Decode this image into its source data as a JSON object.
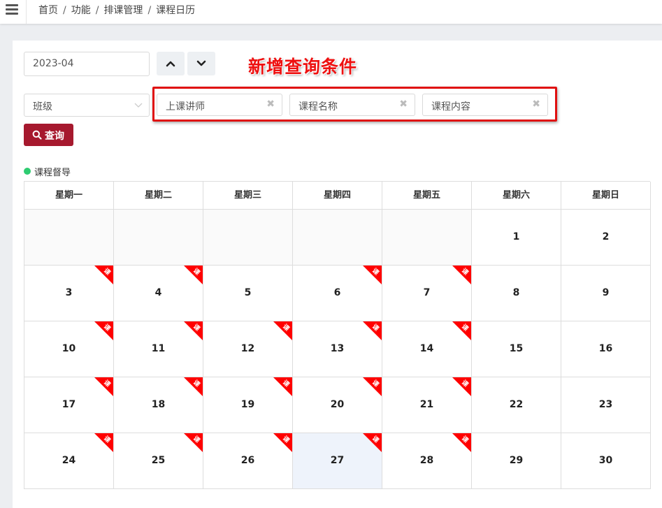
{
  "breadcrumb": {
    "items": [
      "首页",
      "功能",
      "排课管理",
      "课程日历"
    ],
    "separator": "/"
  },
  "filters": {
    "month_value": "2023-04",
    "class_placeholder": "班级",
    "teacher_placeholder": "上课讲师",
    "course_name_placeholder": "课程名称",
    "course_content_placeholder": "课程内容",
    "clear_glyph": "✖",
    "query_label": "查询"
  },
  "annotation": {
    "text": "新增查询条件",
    "color": "#ee1010"
  },
  "legend": {
    "label": "课程督导",
    "color": "#2ecc71"
  },
  "calendar": {
    "weekdays": [
      "星期一",
      "星期二",
      "星期三",
      "星期四",
      "星期五",
      "星期六",
      "星期日"
    ],
    "rows": [
      [
        {
          "day": ""
        },
        {
          "day": ""
        },
        {
          "day": ""
        },
        {
          "day": ""
        },
        {
          "day": ""
        },
        {
          "day": "1"
        },
        {
          "day": "2"
        }
      ],
      [
        {
          "day": "3",
          "tag": "课"
        },
        {
          "day": "4",
          "tag": "课"
        },
        {
          "day": "5"
        },
        {
          "day": "6",
          "tag": "课"
        },
        {
          "day": "7",
          "tag": "课"
        },
        {
          "day": "8"
        },
        {
          "day": "9"
        }
      ],
      [
        {
          "day": "10",
          "tag": "课"
        },
        {
          "day": "11",
          "tag": "课"
        },
        {
          "day": "12",
          "tag": "课"
        },
        {
          "day": "13",
          "tag": "课"
        },
        {
          "day": "14",
          "tag": "课"
        },
        {
          "day": "15"
        },
        {
          "day": "16"
        }
      ],
      [
        {
          "day": "17",
          "tag": "课"
        },
        {
          "day": "18",
          "tag": "课"
        },
        {
          "day": "19",
          "tag": "课"
        },
        {
          "day": "20",
          "tag": "课"
        },
        {
          "day": "21",
          "tag": "课"
        },
        {
          "day": "22"
        },
        {
          "day": "23"
        }
      ],
      [
        {
          "day": "24",
          "tag": "课"
        },
        {
          "day": "25",
          "tag": "课"
        },
        {
          "day": "26",
          "tag": "课"
        },
        {
          "day": "27",
          "tag": "课",
          "today": true
        },
        {
          "day": "28",
          "tag": "课"
        },
        {
          "day": "29"
        },
        {
          "day": "30"
        }
      ]
    ],
    "ribbon_color": "#ff0000",
    "today_color": "#eef3fb"
  },
  "icons": {
    "menu": "hamburger-menu-icon",
    "prev": "chevron-up-icon",
    "next": "chevron-down-icon",
    "dropdown": "chevron-down-icon",
    "search": "search-icon"
  }
}
